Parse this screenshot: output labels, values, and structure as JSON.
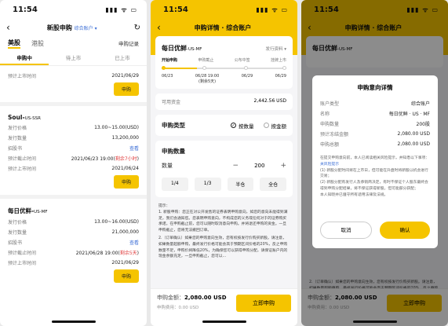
{
  "time": "11:54",
  "status_icons": "▮▮▮ ᯤ ▭",
  "phone1": {
    "title": "新股申购",
    "account": "综合账户",
    "markets": [
      "美股",
      "港股"
    ],
    "record": "申购记录",
    "subtabs": [
      "申购中",
      "待上市",
      "已上市"
    ],
    "partial": [
      {
        "label": "预计上市时间",
        "value": "2021/06/29"
      }
    ],
    "stocks": [
      {
        "name": "Soul",
        "code": "US-SSR",
        "rows": [
          {
            "label": "发行价格",
            "value": "13.00~15.00(USD)"
          },
          {
            "label": "发行数量",
            "value": "13,200,000"
          },
          {
            "label": "招股书",
            "value": "查看"
          },
          {
            "label": "预计截止时间",
            "value": "2021/06/23 19:00(剩余7小时)"
          },
          {
            "label": "预计上市时间",
            "value": "2021/06/24"
          }
        ]
      },
      {
        "name": "每日优鲜",
        "code": "US-MF",
        "rows": [
          {
            "label": "发行价格",
            "value": "13.00~16.00(USD)"
          },
          {
            "label": "发行数量",
            "value": "21,000,000"
          },
          {
            "label": "招股书",
            "value": "查看"
          },
          {
            "label": "预计截止时间",
            "value": "2021/06/28 19:00(剩余5天)"
          },
          {
            "label": "预计上市时间",
            "value": "2021/06/29"
          }
        ]
      }
    ],
    "buy_label": "申购"
  },
  "phone2": {
    "title": "申购详情 · 综合账户",
    "stock": "每日优鲜",
    "code": "-US-MF",
    "prospectus": "发行资料",
    "steps": [
      "开始申购",
      "申购截止",
      "公布中签",
      "挂牌上市"
    ],
    "dates": [
      "06/23",
      "06/28 19:00\n(剩余5天)",
      "06/29",
      "06/29"
    ],
    "cash_label": "可用资金",
    "cash_value": "2,442.56 USD",
    "type_label": "申购类型",
    "type_options": [
      "按数量",
      "按金额"
    ],
    "qty_title": "申购数量",
    "qty_label": "数量",
    "qty_value": "200",
    "quick": [
      "1/4",
      "1/3",
      "半仓",
      "全仓"
    ],
    "tips_title": "提示：",
    "tips": [
      "1. 新股申购：您正在对公开发售的证券表明申购意向，如您的意向未能得到满足，我们会通知您。您表明申购意向，不构成您的义务或任何对于的证券购买承诺。在申购截止前，您可以随时取消意向申购。并将退还申购的资金。一旦申购截止，您将无法撤回订单。",
      "2.（订单确认）如果您的申购意向生效，您有权按发行价购买新股。请注意，如果数量超额申购，最终发行价格可能会高于预期区间价格的20%，反之申购数量不足，申购价将降低20%，为确保您可以获得申购分配，请保证账户内的现金余额充足，一旦申购截止，您可以..."
    ],
    "amount_label": "申购金额：",
    "amount_value": "2,080.00 USD",
    "fee_label": "申购费用：",
    "fee_value": "0.00 USD",
    "submit": "立即申购"
  },
  "phone3": {
    "modal_title": "申购意向详情",
    "rows": [
      {
        "label": "账户类型",
        "value": "综合账户"
      },
      {
        "label": "名称",
        "value": "每日优鲜 · US · MF"
      },
      {
        "label": "申购数量",
        "value": "200股"
      },
      {
        "label": "预计冻结金额",
        "value": "2,080.00 USD"
      },
      {
        "label": "申购总额",
        "value": "2,080.00 USD"
      }
    ],
    "terms": "在提交申购意向前，本人已阅读相关风险提示，并知悉以下事项：",
    "terms_link": "关风险提示",
    "terms_items": [
      "(1) 新股分配时间将在上市日，但可能在升盘时将新股以机会进行交易；",
      "(2) 新股分配有发行人及承销商决定，有时不保证个人股东最终会得到申购分配结果，将不保证获得新股，但可能部分获配；",
      "本人知晓并已遵守所有适用法律及法规。"
    ],
    "cancel": "取消",
    "confirm": "确认"
  }
}
